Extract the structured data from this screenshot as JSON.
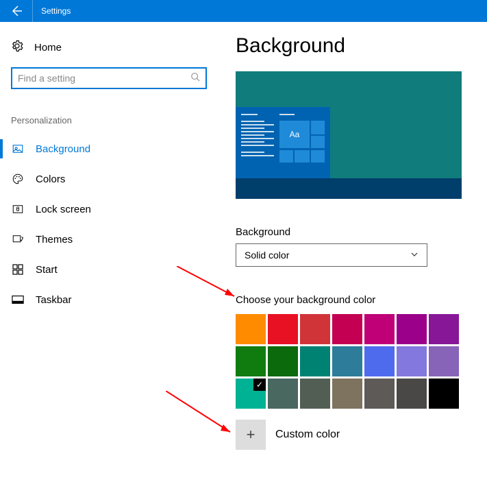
{
  "titlebar": {
    "title": "Settings"
  },
  "sidebar": {
    "home_label": "Home",
    "search_placeholder": "Find a setting",
    "section_label": "Personalization",
    "items": [
      {
        "label": "Background",
        "selected": true
      },
      {
        "label": "Colors",
        "selected": false
      },
      {
        "label": "Lock screen",
        "selected": false
      },
      {
        "label": "Themes",
        "selected": false
      },
      {
        "label": "Start",
        "selected": false
      },
      {
        "label": "Taskbar",
        "selected": false
      }
    ]
  },
  "main": {
    "page_title": "Background",
    "preview_tile_text": "Aa",
    "dropdown_label": "Background",
    "dropdown_value": "Solid color",
    "colors_label": "Choose your background color",
    "colors": [
      {
        "hex": "#ff8c00"
      },
      {
        "hex": "#e81123"
      },
      {
        "hex": "#d13438"
      },
      {
        "hex": "#c30052"
      },
      {
        "hex": "#bf0077"
      },
      {
        "hex": "#9a0089"
      },
      {
        "hex": "#881798"
      },
      {
        "hex": "#107c10"
      },
      {
        "hex": "#0b6a0b"
      },
      {
        "hex": "#008272"
      },
      {
        "hex": "#2d7d9a"
      },
      {
        "hex": "#4f6bed"
      },
      {
        "hex": "#8378de"
      },
      {
        "hex": "#8764b8"
      },
      {
        "hex": "#00b294",
        "selected": true
      },
      {
        "hex": "#486860"
      },
      {
        "hex": "#525e54"
      },
      {
        "hex": "#7e735f"
      },
      {
        "hex": "#5d5a58"
      },
      {
        "hex": "#4a4846"
      },
      {
        "hex": "#000000"
      }
    ],
    "custom_color_label": "Custom color"
  }
}
